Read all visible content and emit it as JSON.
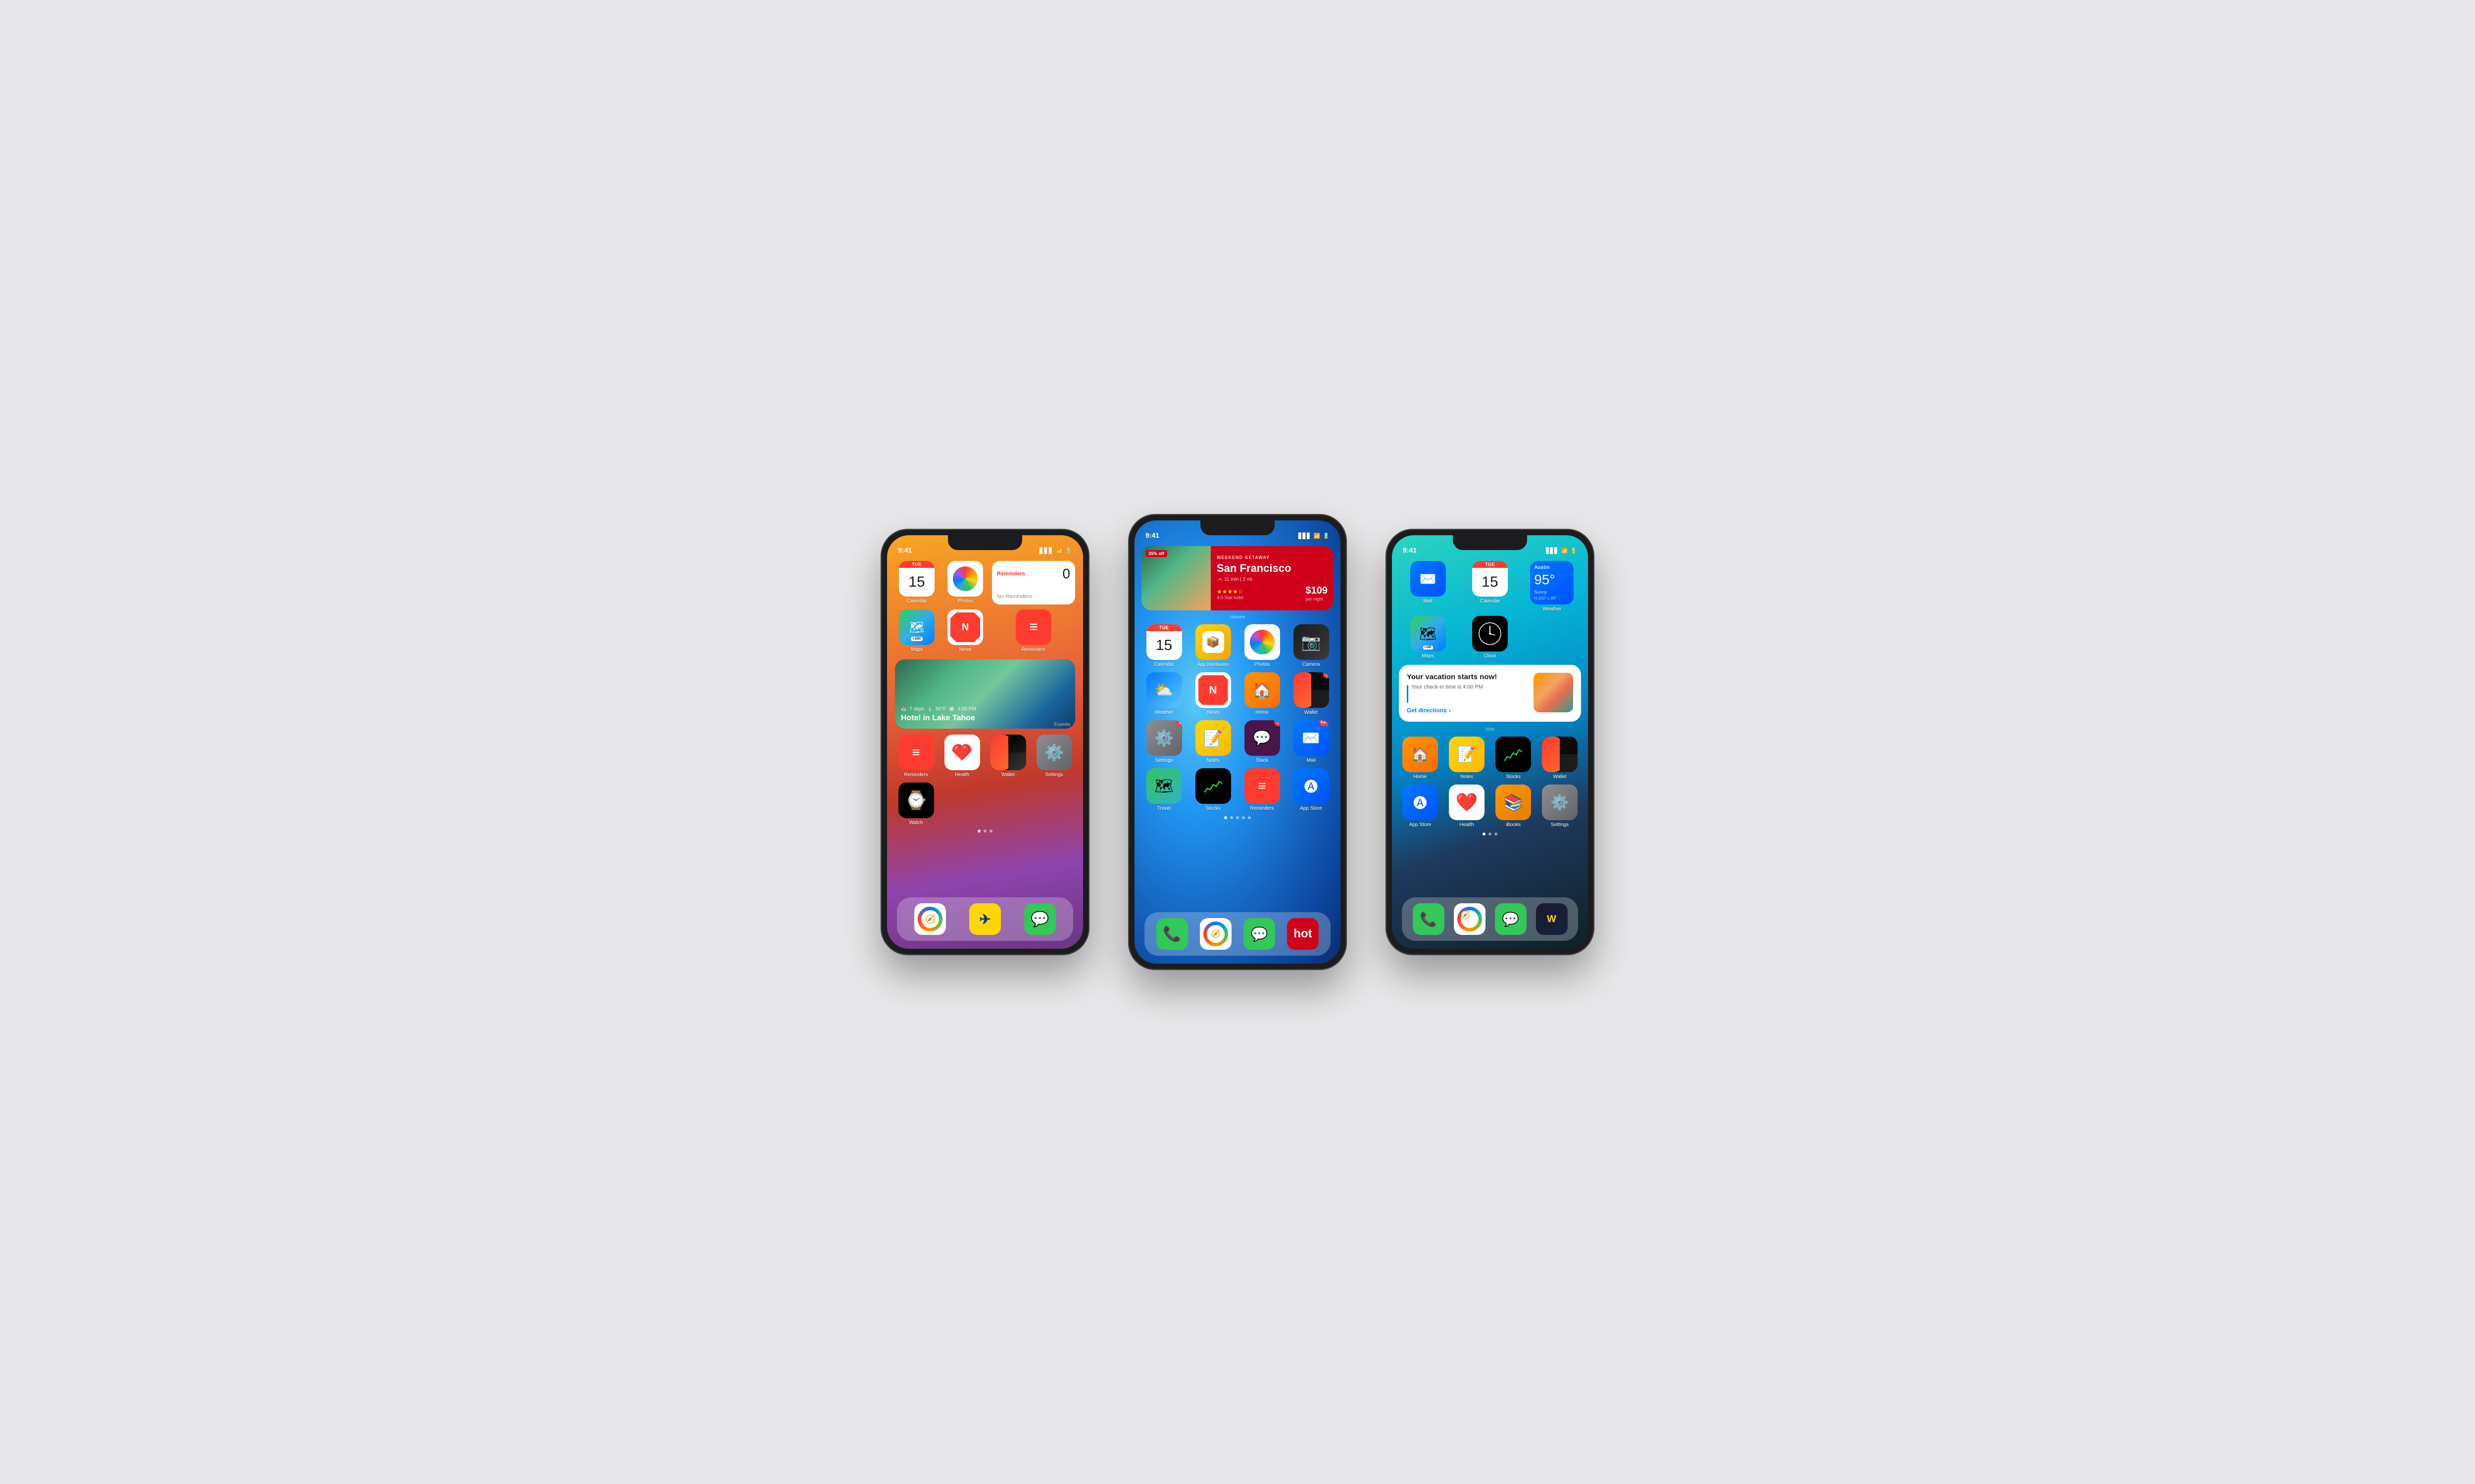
{
  "page": {
    "bg_color": "#e8e8ea"
  },
  "phone1": {
    "status_time": "9:41",
    "status_signal": "▋▋▋",
    "status_wifi": "WiFi",
    "status_battery": "Battery",
    "widgets": {
      "calendar": {
        "day": "TUE",
        "date": "15"
      },
      "photos_label": "Photos",
      "reminders_widget": {
        "title": "Reminders",
        "subtitle": "No Reminders",
        "count": "0"
      },
      "maps_label": "Maps",
      "news_label": "News",
      "reminders_label": "Reminders",
      "expedia_widget": {
        "title": "Hotel in Lake Tahoe",
        "days": "7 days",
        "temp": "80°F",
        "time": "4:00 PM",
        "brand": "Expedia"
      }
    },
    "apps": [
      {
        "name": "Reminders",
        "bg": "#ff3b30"
      },
      {
        "name": "Health",
        "bg": "#ff2d55"
      },
      {
        "name": "Wallet",
        "bg": "#000000"
      },
      {
        "name": "Settings",
        "bg": "#8e8e93"
      },
      {
        "name": "Watch",
        "bg": "#000000"
      }
    ],
    "dock": [
      {
        "name": "Safari",
        "bg": "#0071e3"
      },
      {
        "name": "Expedia",
        "bg": "#ffd60a"
      },
      {
        "name": "Messages",
        "bg": "#34c759"
      }
    ]
  },
  "phone2": {
    "status_time": "9:41",
    "hotwire_widget": {
      "badge": "35% off",
      "title": "San Francisco",
      "subtitle": "WEEKEND GETAWAY",
      "drive": "11 min | 2 mi",
      "stars": "★★★★☆",
      "rating": "4.0-Star hotel",
      "price": "$109",
      "price_unit": "per night",
      "brand": "Hotwire"
    },
    "row1": [
      {
        "name": "Calendar",
        "day": "TUE",
        "date": "15"
      },
      {
        "name": "App Distribution",
        "bg": "#f0a500"
      },
      {
        "name": "Photos",
        "bg": "photos"
      },
      {
        "name": "Camera",
        "bg": "#1c1c1e"
      }
    ],
    "row2": [
      {
        "name": "Weather",
        "bg": "#0071e3"
      },
      {
        "name": "News",
        "bg": "#ff3b30"
      },
      {
        "name": "Home",
        "bg": "#ff9500"
      },
      {
        "name": "Wallet",
        "bg": "#000000",
        "badge": "1"
      }
    ],
    "row3": [
      {
        "name": "Settings",
        "bg": "#8e8e93",
        "badge": "1"
      },
      {
        "name": "Notes",
        "bg": "#ffd60a"
      },
      {
        "name": "Slack",
        "bg": "#4a154b",
        "badge": "1"
      },
      {
        "name": "Mail",
        "bg": "#0071e3",
        "badge": "8,280"
      }
    ],
    "row4": [
      {
        "name": "Travel",
        "bg": "#34c759"
      },
      {
        "name": "Stocks",
        "bg": "#000000"
      },
      {
        "name": "Reminders",
        "bg": "#ff3b30"
      },
      {
        "name": "App Store",
        "bg": "#0071e3"
      }
    ],
    "dock": [
      {
        "name": "Phone",
        "bg": "#34c759"
      },
      {
        "name": "Safari",
        "bg": "#0071e3"
      },
      {
        "name": "Messages",
        "bg": "#34c759"
      },
      {
        "name": "Hotwire",
        "bg": "#d0021b"
      }
    ]
  },
  "phone3": {
    "status_time": "9:41",
    "top_apps": {
      "row1": [
        {
          "name": "Mail",
          "bg": "#0071e3"
        },
        {
          "name": "Calendar",
          "day": "TUE",
          "date": "15"
        }
      ],
      "weather_widget": {
        "city": "Austin",
        "temp": "95°",
        "condition": "Sunny",
        "high": "H:100°",
        "low": "L:85°"
      },
      "row2": [
        {
          "name": "Maps",
          "bg": "maps"
        },
        {
          "name": "Clock",
          "bg": "#000000"
        }
      ]
    },
    "vrbo_widget": {
      "title": "Your vacation starts now!",
      "subtitle": "Your check-in time is 4:00 PM",
      "cta": "Get directions",
      "brand": "Vrbo"
    },
    "apps": [
      {
        "name": "Home",
        "bg": "#ff9500"
      },
      {
        "name": "Notes",
        "bg": "#ffd60a"
      },
      {
        "name": "Stocks",
        "bg": "#000000"
      },
      {
        "name": "Wallet",
        "bg": "#000000"
      },
      {
        "name": "App Store",
        "bg": "#0071e3"
      },
      {
        "name": "Health",
        "bg": "#ff2d55"
      },
      {
        "name": "iBooks",
        "bg": "#ff9500"
      },
      {
        "name": "Settings",
        "bg": "#8e8e93"
      }
    ],
    "dock": [
      {
        "name": "Phone",
        "bg": "#34c759"
      },
      {
        "name": "Safari",
        "bg": "#0071e3"
      },
      {
        "name": "Messages",
        "bg": "#34c759"
      },
      {
        "name": "Wallet2",
        "bg": "#1a1a2e"
      }
    ]
  }
}
